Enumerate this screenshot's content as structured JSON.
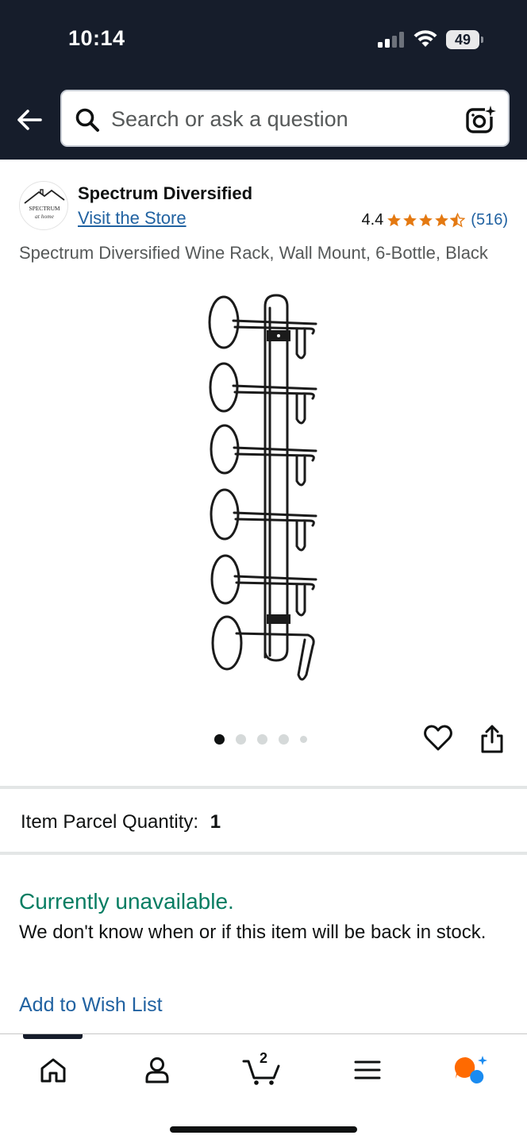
{
  "status_bar": {
    "time": "10:14",
    "battery": "49"
  },
  "header": {
    "search_placeholder": "Search or ask a question"
  },
  "brand": {
    "name": "Spectrum Diversified",
    "visit_store": "Visit the Store",
    "logo_text_top": "SPECTRUM",
    "logo_text_bottom": "at home"
  },
  "rating": {
    "value": "4.4",
    "stars": 4.4,
    "count": "(516)",
    "star_color": "#e47911"
  },
  "product": {
    "title": "Spectrum Diversified Wine Rack, Wall Mount, 6-Bottle, Black"
  },
  "carousel": {
    "total_images": 5,
    "active_index": 0
  },
  "parcel": {
    "label": "Item Parcel Quantity:",
    "value": "1"
  },
  "availability": {
    "status": "Currently unavailable.",
    "status_color": "#067d62",
    "note": "We don't know when or if this item will be back in stock.",
    "wishlist": "Add to Wish List"
  },
  "bottom_nav": {
    "items": [
      "home-icon",
      "account-icon",
      "cart-icon",
      "menu-icon",
      "rufus-icon"
    ],
    "cart_count": "2",
    "active": "home-icon"
  },
  "colors": {
    "header_bg": "#161d2b",
    "link": "#2162a1",
    "accent_orange": "#ff6a00",
    "accent_blue": "#1a8bf0"
  }
}
